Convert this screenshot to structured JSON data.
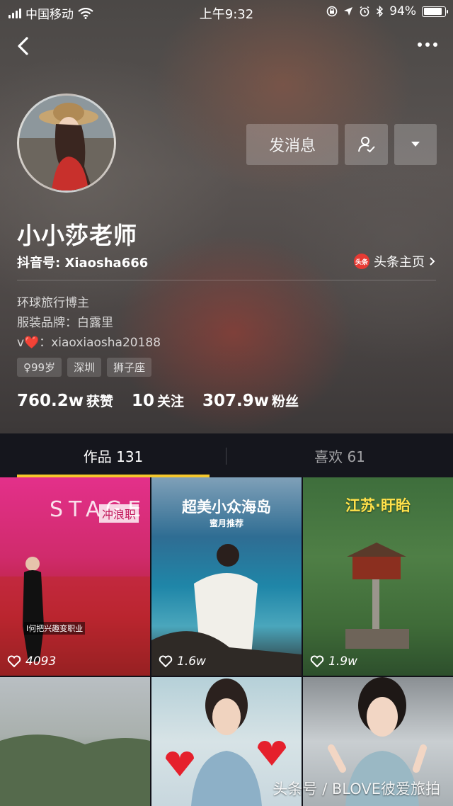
{
  "status_bar": {
    "carrier": "中国移动",
    "time": "上午9:32",
    "battery": "94%",
    "battery_level": 0.94
  },
  "profile": {
    "name": "小小莎老师",
    "douyin_id": "抖音号: Xiaosha666",
    "toutiao_link": "头条主页",
    "toutiao_badge": "头条",
    "message_button": "发消息",
    "bio_line1": "环球旅行博主",
    "bio_line2": "服装品牌：白露里",
    "bio_line3_prefix": "v",
    "bio_line3_heart": "❤️",
    "bio_line3_suffix": "：xiaoxiaosha20188",
    "tags": [
      "♀99岁",
      "深圳",
      "狮子座"
    ],
    "stats": {
      "likes_num": "760.2w",
      "likes_label": "获赞",
      "following_num": "10",
      "following_label": "关注",
      "followers_num": "307.9w",
      "followers_label": "粉丝"
    }
  },
  "tabs": {
    "works": "作品 131",
    "likes": "喜欢 61",
    "active": "works"
  },
  "videos": [
    {
      "likes": "4093",
      "overlay_top": "STAGE",
      "overlay_tag": "冲浪职",
      "caption": "I何把兴趣变职业"
    },
    {
      "likes": "1.6w",
      "title": "超美小众海岛",
      "subtitle": "蜜月推荐"
    },
    {
      "likes": "1.9w",
      "title": "江苏·盱眙"
    },
    {
      "likes": ""
    },
    {
      "likes": ""
    },
    {
      "likes": ""
    }
  ],
  "watermark": "头条号 / BLOVE彼爱旅拍",
  "colors": {
    "tab_underline": "#f5c72c",
    "toutiao_badge": "#e63a33",
    "heart": "#ff3b3b"
  }
}
